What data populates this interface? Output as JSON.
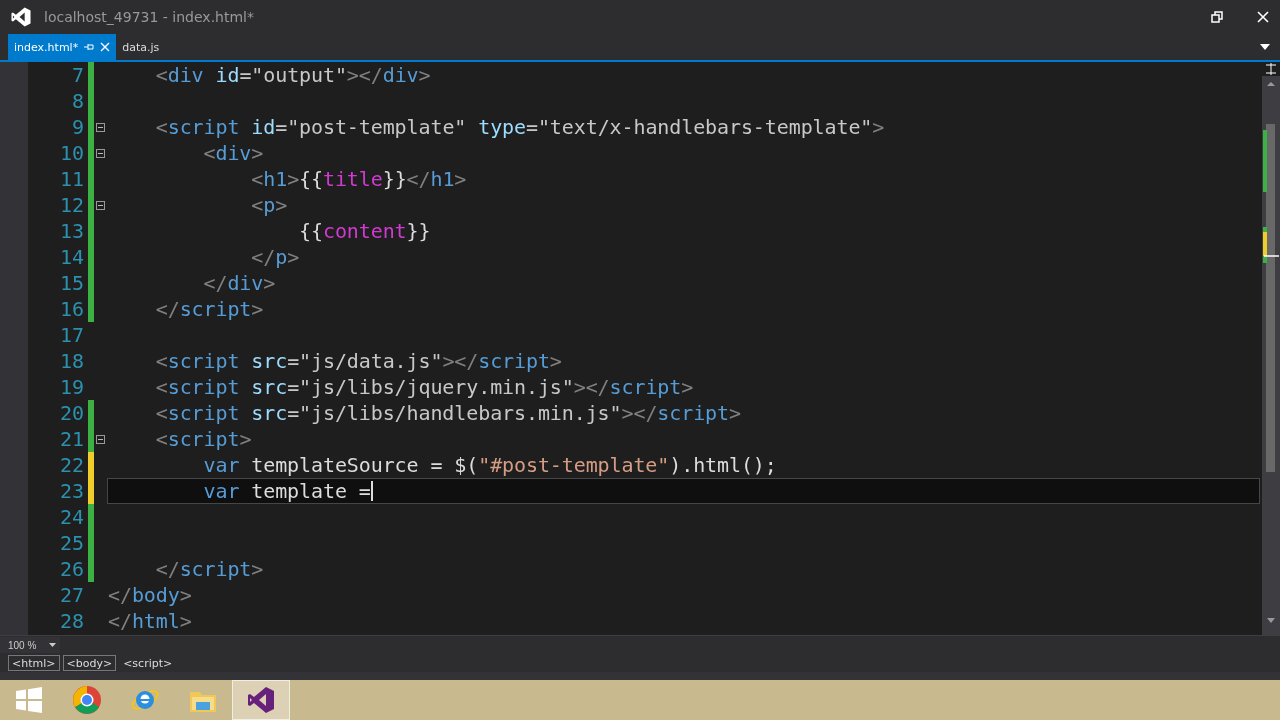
{
  "window": {
    "title": "localhost_49731 - index.html*"
  },
  "tabs": [
    {
      "label": "index.html*",
      "selected": true
    },
    {
      "label": "data.js",
      "selected": false
    }
  ],
  "editor": {
    "lines": [
      {
        "number": "7",
        "changed": true,
        "saved": true,
        "fold": false,
        "current": false,
        "tokens": [
          {
            "kind": "punct",
            "text": "    <"
          },
          {
            "kind": "tag",
            "text": "div"
          },
          {
            "kind": "attr",
            "text": " id"
          },
          {
            "kind": "value",
            "text": "=\"output\""
          },
          {
            "kind": "punct",
            "text": "></"
          },
          {
            "kind": "tag",
            "text": "div"
          },
          {
            "kind": "punct",
            "text": ">"
          }
        ]
      },
      {
        "number": "8",
        "changed": true,
        "saved": true,
        "fold": false,
        "current": false
      },
      {
        "number": "9",
        "changed": true,
        "saved": true,
        "fold": true,
        "current": false,
        "tokens": [
          {
            "kind": "punct",
            "text": "    <"
          },
          {
            "kind": "tag",
            "text": "script"
          },
          {
            "kind": "attr",
            "text": " id"
          },
          {
            "kind": "value",
            "text": "=\"post-template\""
          },
          {
            "kind": "attr",
            "text": " type"
          },
          {
            "kind": "value",
            "text": "=\"text/x-handlebars-template\""
          },
          {
            "kind": "punct",
            "text": ">"
          }
        ]
      },
      {
        "number": "10",
        "changed": true,
        "saved": true,
        "fold": true,
        "current": false,
        "tokens": [
          {
            "kind": "punct",
            "text": "        <"
          },
          {
            "kind": "tag",
            "text": "div"
          },
          {
            "kind": "punct",
            "text": ">"
          }
        ]
      },
      {
        "number": "11",
        "changed": true,
        "saved": true,
        "fold": false,
        "current": false,
        "tokens": [
          {
            "kind": "punct",
            "text": "            <"
          },
          {
            "kind": "tag",
            "text": "h1"
          },
          {
            "kind": "punct",
            "text": ">"
          },
          {
            "kind": "brace",
            "text": "{{"
          },
          {
            "kind": "variable",
            "text": "title"
          },
          {
            "kind": "brace",
            "text": "}}"
          },
          {
            "kind": "punct",
            "text": "</"
          },
          {
            "kind": "tag",
            "text": "h1"
          },
          {
            "kind": "punct",
            "text": ">"
          }
        ]
      },
      {
        "number": "12",
        "changed": true,
        "saved": true,
        "fold": true,
        "current": false,
        "tokens": [
          {
            "kind": "punct",
            "text": "            <"
          },
          {
            "kind": "tag",
            "text": "p"
          },
          {
            "kind": "punct",
            "text": ">"
          }
        ]
      },
      {
        "number": "13",
        "changed": true,
        "saved": true,
        "fold": false,
        "current": false,
        "tokens": [
          {
            "kind": "brace",
            "text": "                {{"
          },
          {
            "kind": "variable",
            "text": "content"
          },
          {
            "kind": "brace",
            "text": "}}"
          }
        ]
      },
      {
        "number": "14",
        "changed": true,
        "saved": true,
        "fold": false,
        "current": false,
        "tokens": [
          {
            "kind": "punct",
            "text": "            </"
          },
          {
            "kind": "tag",
            "text": "p"
          },
          {
            "kind": "punct",
            "text": ">"
          }
        ]
      },
      {
        "number": "15",
        "changed": true,
        "saved": true,
        "fold": false,
        "current": false,
        "tokens": [
          {
            "kind": "punct",
            "text": "        </"
          },
          {
            "kind": "tag",
            "text": "div"
          },
          {
            "kind": "punct",
            "text": ">"
          }
        ]
      },
      {
        "number": "16",
        "changed": true,
        "saved": true,
        "fold": false,
        "current": false,
        "tokens": [
          {
            "kind": "punct",
            "text": "    </"
          },
          {
            "kind": "tag",
            "text": "script"
          },
          {
            "kind": "punct",
            "text": ">"
          }
        ]
      },
      {
        "number": "17",
        "changed": false,
        "fold": false,
        "current": false
      },
      {
        "number": "18",
        "changed": false,
        "fold": false,
        "current": false,
        "tokens": [
          {
            "kind": "punct",
            "text": "    <"
          },
          {
            "kind": "tag",
            "text": "script"
          },
          {
            "kind": "attr",
            "text": " src"
          },
          {
            "kind": "value",
            "text": "=\"js/data.js\""
          },
          {
            "kind": "punct",
            "text": "></"
          },
          {
            "kind": "tag",
            "text": "script"
          },
          {
            "kind": "punct",
            "text": ">"
          }
        ]
      },
      {
        "number": "19",
        "changed": false,
        "fold": false,
        "current": false,
        "tokens": [
          {
            "kind": "punct",
            "text": "    <"
          },
          {
            "kind": "tag",
            "text": "script"
          },
          {
            "kind": "attr",
            "text": " src"
          },
          {
            "kind": "value",
            "text": "=\"js/libs/jquery.min.js\""
          },
          {
            "kind": "punct",
            "text": "></"
          },
          {
            "kind": "tag",
            "text": "script"
          },
          {
            "kind": "punct",
            "text": ">"
          }
        ]
      },
      {
        "number": "20",
        "changed": true,
        "saved": true,
        "fold": false,
        "current": false,
        "tokens": [
          {
            "kind": "punct",
            "text": "    <"
          },
          {
            "kind": "tag",
            "text": "script"
          },
          {
            "kind": "attr",
            "text": " src"
          },
          {
            "kind": "value",
            "text": "=\"js/libs/handlebars.min.js\""
          },
          {
            "kind": "punct",
            "text": "></"
          },
          {
            "kind": "tag",
            "text": "script"
          },
          {
            "kind": "punct",
            "text": ">"
          }
        ]
      },
      {
        "number": "21",
        "changed": true,
        "saved": true,
        "fold": true,
        "current": false,
        "tokens": [
          {
            "kind": "punct",
            "text": "    <"
          },
          {
            "kind": "tag",
            "text": "script"
          },
          {
            "kind": "punct",
            "text": ">"
          }
        ]
      },
      {
        "number": "22",
        "changed": true,
        "saved": false,
        "fold": false,
        "current": false,
        "tokens": [
          {
            "kind": "keyword",
            "text": "        var"
          },
          {
            "kind": "plain",
            "text": " templateSource = $("
          },
          {
            "kind": "string",
            "text": "\"#post-template\""
          },
          {
            "kind": "plain",
            "text": ").html();"
          }
        ]
      },
      {
        "number": "23",
        "changed": true,
        "saved": false,
        "fold": false,
        "current": true,
        "tokens": [
          {
            "kind": "keyword",
            "text": "        var"
          },
          {
            "kind": "plain",
            "text": " template ="
          }
        ]
      },
      {
        "number": "24",
        "changed": true,
        "saved": true,
        "fold": false,
        "current": false
      },
      {
        "number": "25",
        "changed": true,
        "saved": true,
        "fold": false,
        "current": false
      },
      {
        "number": "26",
        "changed": true,
        "saved": true,
        "fold": false,
        "current": false,
        "tokens": [
          {
            "kind": "punct",
            "text": "    </"
          },
          {
            "kind": "tag",
            "text": "script"
          },
          {
            "kind": "punct",
            "text": ">"
          }
        ]
      },
      {
        "number": "27",
        "changed": false,
        "fold": false,
        "current": false,
        "tokens": [
          {
            "kind": "punct",
            "text": "</"
          },
          {
            "kind": "tag",
            "text": "body"
          },
          {
            "kind": "punct",
            "text": ">"
          }
        ]
      },
      {
        "number": "28",
        "changed": false,
        "fold": false,
        "current": false,
        "tokens": [
          {
            "kind": "punct",
            "text": "</"
          },
          {
            "kind": "tag",
            "text": "html"
          },
          {
            "kind": "punct",
            "text": ">"
          }
        ]
      }
    ]
  },
  "zoom": "100 %",
  "breadcrumb": [
    {
      "label": "<html>",
      "selected": false
    },
    {
      "label": "<body>",
      "selected": false
    },
    {
      "label": "<script>",
      "selected": true
    }
  ],
  "taskbar": {
    "apps": [
      {
        "kind": "chrome",
        "selected": false
      },
      {
        "kind": "ie",
        "selected": false
      },
      {
        "kind": "explorer",
        "selected": false
      },
      {
        "kind": "studio",
        "selected": true
      }
    ]
  }
}
